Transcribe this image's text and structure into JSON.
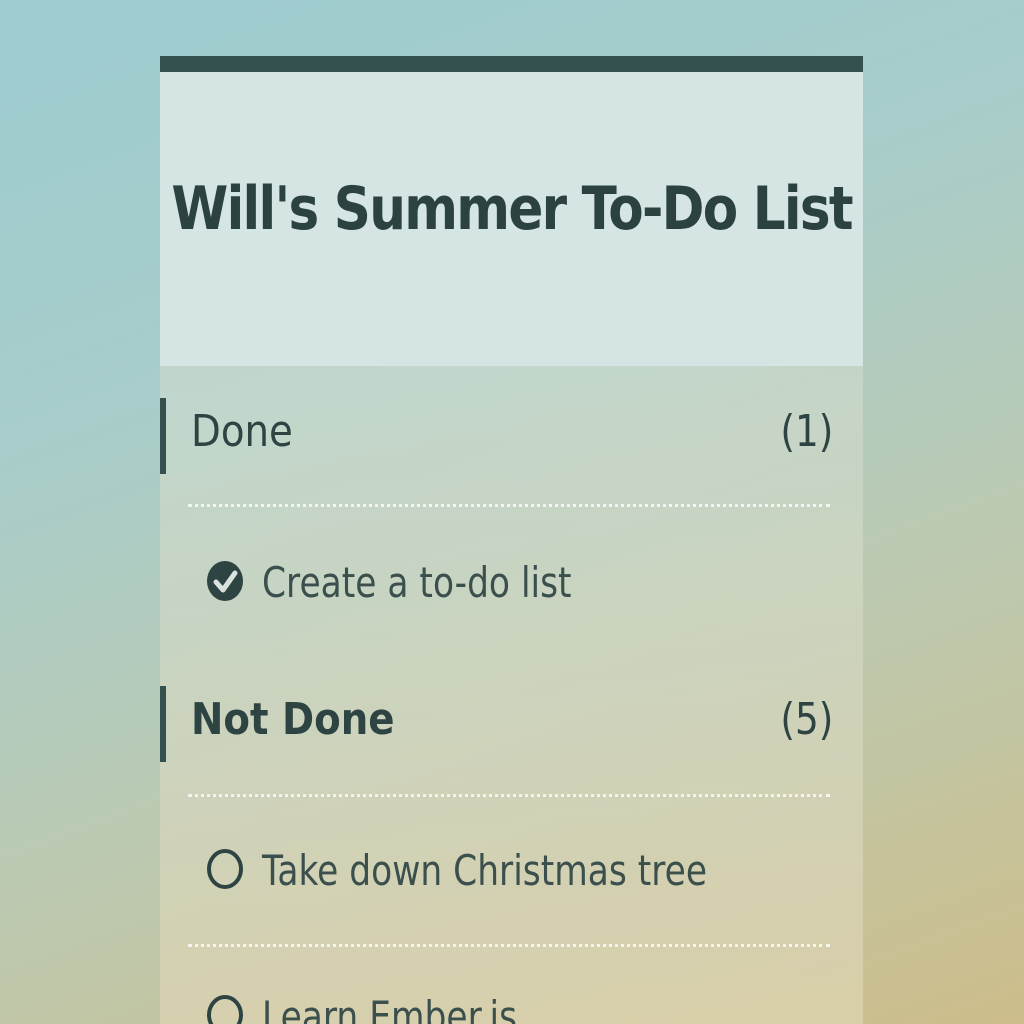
{
  "app": {
    "title": "Will's Summer To-Do List"
  },
  "sections": [
    {
      "label": "Done",
      "count": "(1)",
      "items": [
        {
          "text": "Create a to-do list",
          "done": true,
          "icon": "checked-circle-icon"
        }
      ]
    },
    {
      "label": "Not Done",
      "count": "(5)",
      "items": [
        {
          "text": "Take down Christmas tree",
          "done": false,
          "icon": "unchecked-circle-icon"
        },
        {
          "text": "Learn Ember.js",
          "done": false,
          "icon": "unchecked-circle-icon"
        }
      ]
    }
  ],
  "colors": {
    "accent": "#34514f",
    "header_bg": "#d4e5e4",
    "text": "#2e4443"
  }
}
